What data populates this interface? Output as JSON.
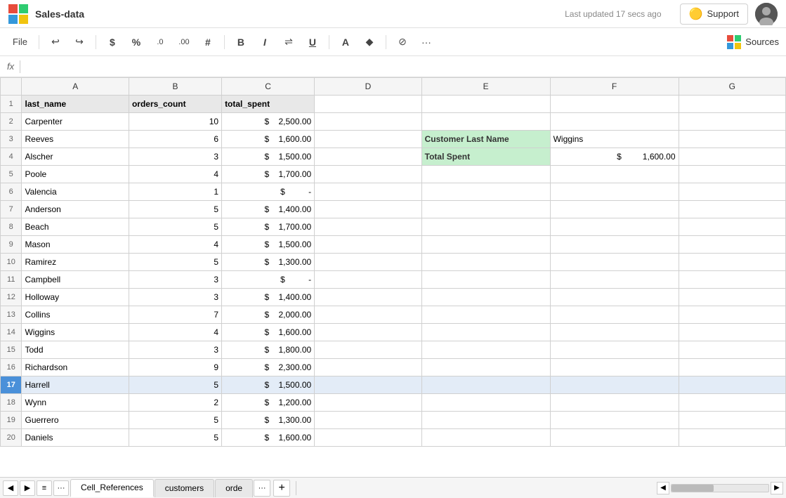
{
  "titlebar": {
    "app_name": "Sales-data",
    "last_updated": "Last updated 17 secs ago",
    "support_label": "Support",
    "user_initial": ""
  },
  "toolbar": {
    "file_label": "File",
    "undo_icon": "↩",
    "redo_icon": "↪",
    "dollar_icon": "$",
    "percent_icon": "%",
    "decimal_dec_icon": ".0",
    "decimal_inc_icon": ".00",
    "hash_icon": "#",
    "bold_icon": "B",
    "italic_icon": "I",
    "align_icon": "⇌",
    "underline_icon": "U",
    "font_color_icon": "A",
    "fill_color_icon": "◆",
    "no_border_icon": "⊘",
    "more_icon": "···",
    "sources_label": "Sources"
  },
  "formula_bar": {
    "label": "fx"
  },
  "columns": [
    {
      "id": "corner",
      "label": ""
    },
    {
      "id": "A",
      "label": "A"
    },
    {
      "id": "B",
      "label": "B"
    },
    {
      "id": "C",
      "label": "C"
    },
    {
      "id": "D",
      "label": "D"
    },
    {
      "id": "E",
      "label": "E"
    },
    {
      "id": "F",
      "label": "F"
    },
    {
      "id": "G",
      "label": "G"
    }
  ],
  "rows": [
    {
      "num": 1,
      "a": "last_name",
      "b": "orders_count",
      "c": "total_spent",
      "d": "",
      "e": "",
      "f": "",
      "g": "",
      "highlight": false
    },
    {
      "num": 2,
      "a": "Carpenter",
      "b": "10",
      "c": "2,500.00",
      "d": "",
      "e": "",
      "f": "",
      "g": "",
      "highlight": false
    },
    {
      "num": 3,
      "a": "Reeves",
      "b": "6",
      "c": "1,600.00",
      "d": "",
      "e": "",
      "f": "",
      "g": "",
      "highlight": false
    },
    {
      "num": 4,
      "a": "Alscher",
      "b": "3",
      "c": "1,500.00",
      "d": "",
      "e": "",
      "f": "",
      "g": "",
      "highlight": false
    },
    {
      "num": 5,
      "a": "Poole",
      "b": "4",
      "c": "1,700.00",
      "d": "",
      "e": "",
      "f": "",
      "g": "",
      "highlight": false
    },
    {
      "num": 6,
      "a": "Valencia",
      "b": "1",
      "c": "-",
      "d": "",
      "e": "",
      "f": "",
      "g": "",
      "highlight": false
    },
    {
      "num": 7,
      "a": "Anderson",
      "b": "5",
      "c": "1,400.00",
      "d": "",
      "e": "",
      "f": "",
      "g": "",
      "highlight": false
    },
    {
      "num": 8,
      "a": "Beach",
      "b": "5",
      "c": "1,700.00",
      "d": "",
      "e": "",
      "f": "",
      "g": "",
      "highlight": false
    },
    {
      "num": 9,
      "a": "Mason",
      "b": "4",
      "c": "1,500.00",
      "d": "",
      "e": "",
      "f": "",
      "g": "",
      "highlight": false
    },
    {
      "num": 10,
      "a": "Ramirez",
      "b": "5",
      "c": "1,300.00",
      "d": "",
      "e": "",
      "f": "",
      "g": "",
      "highlight": false
    },
    {
      "num": 11,
      "a": "Campbell",
      "b": "3",
      "c": "-",
      "d": "",
      "e": "",
      "f": "",
      "g": "",
      "highlight": false
    },
    {
      "num": 12,
      "a": "Holloway",
      "b": "3",
      "c": "1,400.00",
      "d": "",
      "e": "",
      "f": "",
      "g": "",
      "highlight": false
    },
    {
      "num": 13,
      "a": "Collins",
      "b": "7",
      "c": "2,000.00",
      "d": "",
      "e": "",
      "f": "",
      "g": "",
      "highlight": false
    },
    {
      "num": 14,
      "a": "Wiggins",
      "b": "4",
      "c": "1,600.00",
      "d": "",
      "e": "",
      "f": "",
      "g": "",
      "highlight": false
    },
    {
      "num": 15,
      "a": "Todd",
      "b": "3",
      "c": "1,800.00",
      "d": "",
      "e": "",
      "f": "",
      "g": "",
      "highlight": false
    },
    {
      "num": 16,
      "a": "Richardson",
      "b": "9",
      "c": "2,300.00",
      "d": "",
      "e": "",
      "f": "",
      "g": "",
      "highlight": false
    },
    {
      "num": 17,
      "a": "Harrell",
      "b": "5",
      "c": "1,500.00",
      "d": "",
      "e": "",
      "f": "",
      "g": "",
      "highlight": true
    },
    {
      "num": 18,
      "a": "Wynn",
      "b": "2",
      "c": "1,200.00",
      "d": "",
      "e": "",
      "f": "",
      "g": "",
      "highlight": false
    },
    {
      "num": 19,
      "a": "Guerrero",
      "b": "5",
      "c": "1,300.00",
      "d": "",
      "e": "",
      "f": "",
      "g": "",
      "highlight": false
    },
    {
      "num": 20,
      "a": "Daniels",
      "b": "5",
      "c": "1,600.00",
      "d": "",
      "e": "",
      "f": "",
      "g": "",
      "highlight": false
    }
  ],
  "lookup_box": {
    "e3_label": "Customer Last Name",
    "e4_label": "Total Spent",
    "f3_value": "Wiggins",
    "f4_dollar": "$",
    "f4_value": "1,600.00"
  },
  "tabs": [
    {
      "id": "cell-references",
      "label": "Cell_References",
      "active": true
    },
    {
      "id": "customers",
      "label": "customers",
      "active": false
    },
    {
      "id": "orde",
      "label": "orde",
      "active": false
    }
  ],
  "bottom": {
    "more_label": "···",
    "add_label": "+",
    "scroll_left": "◀",
    "scroll_right": "▶",
    "scroll_start": "◀◀",
    "scroll_end": "▶▶"
  }
}
